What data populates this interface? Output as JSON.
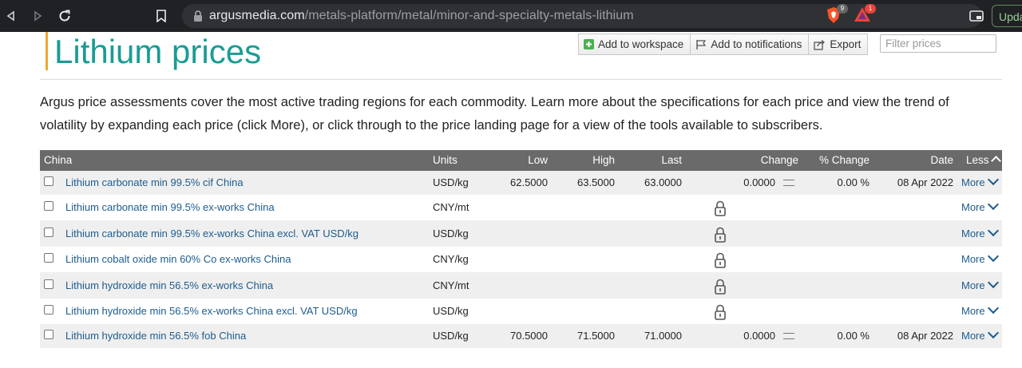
{
  "browser": {
    "url_host": "argusmedia.com",
    "url_path": "/metals-platform/metal/minor-and-specialty-metals-lithium",
    "brave_badge": "9",
    "alert_badge": "1",
    "update_label": "Upda"
  },
  "page": {
    "title": "Lithium prices",
    "intro": "Argus price assessments cover the most active trading regions for each commodity. Learn more about the specifications for each price and view the trend of volatility by expanding each price (click More), or click through to the price landing page for a view of the tools available to subscribers."
  },
  "toolbar": {
    "workspace_label": "Add to workspace",
    "notifications_label": "Add to notifications",
    "export_label": "Export",
    "filter_placeholder": "Filter prices"
  },
  "table": {
    "headers": {
      "region": "China",
      "units": "Units",
      "low": "Low",
      "high": "High",
      "last": "Last",
      "change": "Change",
      "pct_change": "% Change",
      "date": "Date",
      "less": "Less"
    },
    "rows": [
      {
        "name": "Lithium carbonate min 99.5% cif China",
        "units": "USD/kg",
        "low": "62.5000",
        "high": "63.5000",
        "last": "63.0000",
        "change": "0.0000",
        "pct_change": "0.00 %",
        "date": "08 Apr 2022",
        "locked": false,
        "more": "More"
      },
      {
        "name": "Lithium carbonate min 99.5% ex-works China",
        "units": "CNY/mt",
        "locked": true,
        "more": "More"
      },
      {
        "name": "Lithium carbonate min 99.5% ex-works China excl. VAT USD/kg",
        "units": "USD/kg",
        "locked": true,
        "more": "More"
      },
      {
        "name": "Lithium cobalt oxide min 60% Co ex-works China",
        "units": "CNY/kg",
        "locked": true,
        "more": "More"
      },
      {
        "name": "Lithium hydroxide min 56.5% ex-works China",
        "units": "CNY/mt",
        "locked": true,
        "more": "More"
      },
      {
        "name": "Lithium hydroxide min 56.5% ex-works China excl. VAT USD/kg",
        "units": "USD/kg",
        "locked": true,
        "more": "More"
      },
      {
        "name": "Lithium hydroxide min 56.5% fob China",
        "units": "USD/kg",
        "low": "70.5000",
        "high": "71.5000",
        "last": "71.0000",
        "change": "0.0000",
        "pct_change": "0.00 %",
        "date": "08 Apr 2022",
        "locked": false,
        "more": "More"
      }
    ]
  }
}
